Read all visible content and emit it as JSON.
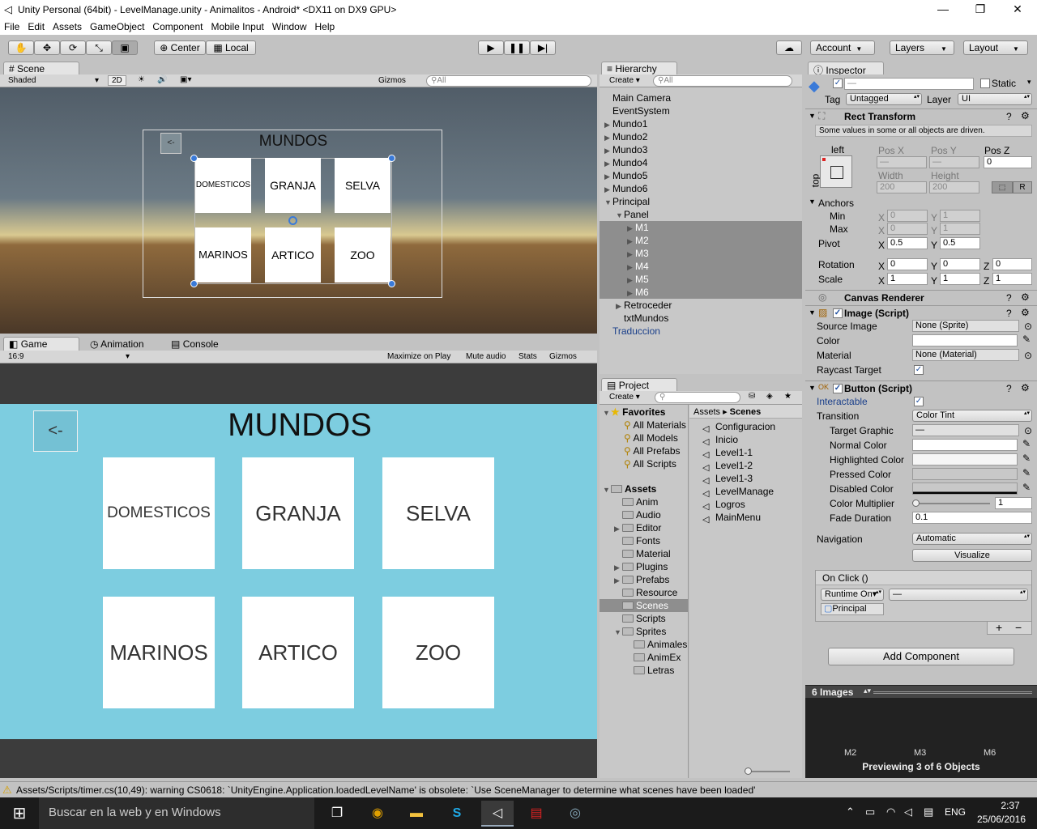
{
  "window": {
    "title": "Unity Personal (64bit) - LevelManage.unity - Animalitos - Android* <DX11 on DX9 GPU>",
    "minimize": "—",
    "restore": "❐",
    "close": "✕"
  },
  "menu": [
    "File",
    "Edit",
    "Assets",
    "GameObject",
    "Component",
    "Mobile Input",
    "Window",
    "Help"
  ],
  "toolbar": {
    "center": "Center",
    "local": "Local",
    "account": "Account",
    "layers": "Layers",
    "layout": "Layout"
  },
  "scene_panel": {
    "tab": "Scene",
    "shading": "Shaded",
    "mode_2d": "2D",
    "gizmos": "Gizmos",
    "search_placeholder": "All"
  },
  "scene_canvas": {
    "title": "MUNDOS",
    "back": "<-",
    "buttons": [
      "DOMESTICOS",
      "GRANJA",
      "SELVA",
      "MARINOS",
      "ARTICO",
      "ZOO"
    ]
  },
  "game_panel": {
    "tabs": [
      "Game",
      "Animation",
      "Console"
    ],
    "aspect": "16:9",
    "maximize": "Maximize on Play",
    "mute": "Mute audio",
    "stats": "Stats",
    "gizmos": "Gizmos"
  },
  "game_canvas": {
    "title": "MUNDOS",
    "back": "<-",
    "buttons": [
      "DOMESTICOS",
      "GRANJA",
      "SELVA",
      "MARINOS",
      "ARTICO",
      "ZOO"
    ]
  },
  "hierarchy": {
    "tab": "Hierarchy",
    "create": "Create",
    "search_placeholder": "All",
    "items": [
      {
        "label": "Main Camera",
        "tri": ""
      },
      {
        "label": "EventSystem",
        "tri": ""
      },
      {
        "label": "Mundo1",
        "tri": "▶"
      },
      {
        "label": "Mundo2",
        "tri": "▶"
      },
      {
        "label": "Mundo3",
        "tri": "▶"
      },
      {
        "label": "Mundo4",
        "tri": "▶"
      },
      {
        "label": "Mundo5",
        "tri": "▶"
      },
      {
        "label": "Mundo6",
        "tri": "▶"
      },
      {
        "label": "Principal",
        "tri": "▼"
      },
      {
        "label": "Panel",
        "tri": "▼"
      },
      {
        "label": "M1",
        "tri": "▶"
      },
      {
        "label": "M2",
        "tri": "▶"
      },
      {
        "label": "M3",
        "tri": "▶"
      },
      {
        "label": "M4",
        "tri": "▶"
      },
      {
        "label": "M5",
        "tri": "▶"
      },
      {
        "label": "M6",
        "tri": "▶"
      },
      {
        "label": "Retroceder",
        "tri": "▶"
      },
      {
        "label": "txtMundos",
        "tri": ""
      },
      {
        "label": "Traduccion",
        "tri": ""
      }
    ]
  },
  "project": {
    "tab": "Project",
    "create": "Create",
    "favorites_header": "Favorites",
    "favorites": [
      "All Materials",
      "All Models",
      "All Prefabs",
      "All Scripts"
    ],
    "assets_header": "Assets",
    "folders": [
      "Anim",
      "Audio",
      "Editor",
      "Fonts",
      "Material",
      "Plugins",
      "Prefabs",
      "Resource",
      "Scenes",
      "Scripts",
      "Sprites"
    ],
    "sprite_folders": [
      "Animales",
      "AnimEx",
      "Letras"
    ],
    "breadcrumb": [
      "Assets",
      "Scenes"
    ],
    "scenes": [
      "Configuracion",
      "Inicio",
      "Level1-1",
      "Level1-2",
      "Level1-3",
      "LevelManage",
      "Logros",
      "MainMenu"
    ]
  },
  "inspector": {
    "tab": "Inspector",
    "name_value": "—",
    "static": "Static",
    "tag_label": "Tag",
    "tag": "Untagged",
    "layer_label": "Layer",
    "layer": "UI",
    "rect": {
      "title": "Rect Transform",
      "notice": "Some values in some or all objects are driven.",
      "anchor_h": "left",
      "anchor_v": "top",
      "pos_x_label": "Pos X",
      "pos_y_label": "Pos Y",
      "pos_z_label": "Pos Z",
      "pos_x": "—",
      "pos_y": "—",
      "pos_z": "0",
      "width_label": "Width",
      "height_label": "Height",
      "width": "200",
      "height": "200",
      "r": "R",
      "anchors": "Anchors",
      "min": "Min",
      "max": "Max",
      "pivot": "Pivot",
      "rotation": "Rotation",
      "scale": "Scale",
      "min_x": "0",
      "min_y": "1",
      "max_x": "0",
      "max_y": "1",
      "pivot_x": "0.5",
      "pivot_y": "0.5",
      "rot_x": "0",
      "rot_y": "0",
      "rot_z": "0",
      "scale_x": "1",
      "scale_y": "1",
      "scale_z": "1"
    },
    "canvas_renderer": "Canvas Renderer",
    "image": {
      "title": "Image (Script)",
      "source_label": "Source Image",
      "source": "None (Sprite)",
      "color_label": "Color",
      "material_label": "Material",
      "material": "None (Material)",
      "raycast_label": "Raycast Target"
    },
    "button": {
      "title": "Button (Script)",
      "interactable": "Interactable",
      "transition_label": "Transition",
      "transition": "Color Tint",
      "target_graphic": "Target Graphic",
      "target_value": "—",
      "normal": "Normal Color",
      "highlighted": "Highlighted Color",
      "pressed": "Pressed Color",
      "disabled": "Disabled Color",
      "multiplier": "Color Multiplier",
      "multiplier_value": "1",
      "fade": "Fade Duration",
      "fade_value": "0.1",
      "navigation": "Navigation",
      "navigation_value": "Automatic",
      "visualize": "Visualize",
      "onclick": "On Click ()",
      "runtime": "Runtime On▾",
      "function": "—",
      "object": "Principal",
      "plus": "+",
      "minus": "−"
    },
    "add_component": "Add Component",
    "preview": {
      "header": "6 Images",
      "labels": [
        "M2",
        "M3",
        "M6"
      ],
      "caption": "Previewing 3 of 6 Objects"
    }
  },
  "status": "Assets/Scripts/timer.cs(10,49): warning CS0618: `UnityEngine.Application.loadedLevelName' is obsolete: `Use SceneManager to determine what scenes have been loaded'",
  "taskbar": {
    "search": "Buscar en la web y en Windows",
    "lang": "ENG",
    "time": "2:37",
    "date": "25/06/2016"
  }
}
